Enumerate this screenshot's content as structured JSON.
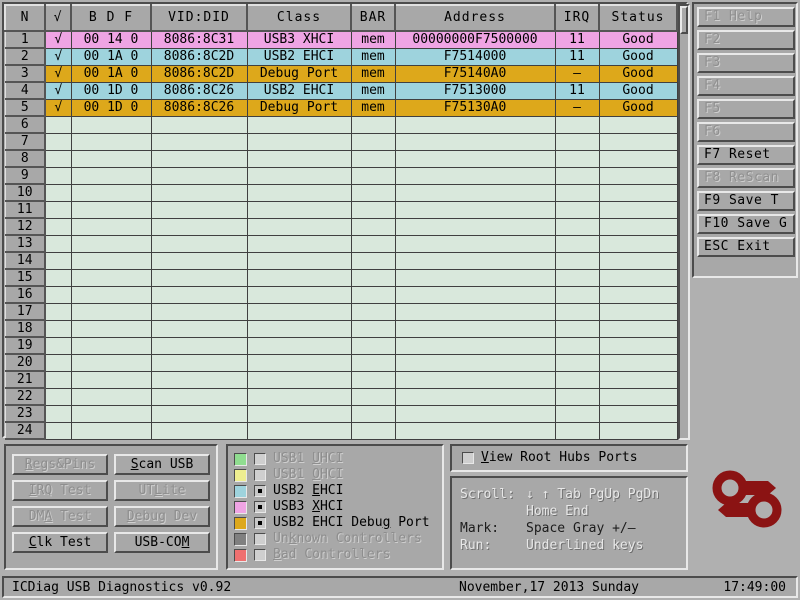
{
  "app": {
    "title": "ICDiag USB Diagnostics",
    "version": "v0.92"
  },
  "statusbar": {
    "left": "ICDiag USB Diagnostics  v0.92",
    "date": "November,17  2013  Sunday",
    "time": "17:49:00"
  },
  "table": {
    "columns": [
      "N",
      "√",
      "B  D  F",
      "VID:DID",
      "Class",
      "BAR",
      "Address",
      "IRQ",
      "Status"
    ],
    "rows": [
      {
        "n": "1",
        "mark": "√",
        "bdf": "00 14 0",
        "viddid": "8086:8C31",
        "class": "USB3 XHCI",
        "bar": "mem",
        "address": "00000000F7500000",
        "irq": "11",
        "status": "Good",
        "color": "c-magenta",
        "selected": false
      },
      {
        "n": "2",
        "mark": "√",
        "bdf": "00 1A 0",
        "viddid": "8086:8C2D",
        "class": "USB2 EHCI",
        "bar": "mem",
        "address": "F7514000",
        "irq": "11",
        "status": "Good",
        "color": "c-cyan",
        "selected": false
      },
      {
        "n": "3",
        "mark": "√",
        "bdf": "00 1A 0",
        "viddid": "8086:8C2D",
        "class": "Debug Port",
        "bar": "mem",
        "address": "F75140A0",
        "irq": "–",
        "status": "Good",
        "color": "c-amber",
        "selected": true
      },
      {
        "n": "4",
        "mark": "√",
        "bdf": "00 1D 0",
        "viddid": "8086:8C26",
        "class": "USB2 EHCI",
        "bar": "mem",
        "address": "F7513000",
        "irq": "11",
        "status": "Good",
        "color": "c-cyan",
        "selected": false
      },
      {
        "n": "5",
        "mark": "√",
        "bdf": "00 1D 0",
        "viddid": "8086:8C26",
        "class": "Debug Port",
        "bar": "mem",
        "address": "F75130A0",
        "irq": "–",
        "status": "Good",
        "color": "c-amber",
        "selected": false
      },
      {
        "n": "6",
        "mark": "",
        "bdf": "",
        "viddid": "",
        "class": "",
        "bar": "",
        "address": "",
        "irq": "",
        "status": "",
        "color": "c-empty",
        "selected": false
      },
      {
        "n": "7",
        "mark": "",
        "bdf": "",
        "viddid": "",
        "class": "",
        "bar": "",
        "address": "",
        "irq": "",
        "status": "",
        "color": "c-empty",
        "selected": false
      },
      {
        "n": "8",
        "mark": "",
        "bdf": "",
        "viddid": "",
        "class": "",
        "bar": "",
        "address": "",
        "irq": "",
        "status": "",
        "color": "c-empty",
        "selected": false
      },
      {
        "n": "9",
        "mark": "",
        "bdf": "",
        "viddid": "",
        "class": "",
        "bar": "",
        "address": "",
        "irq": "",
        "status": "",
        "color": "c-empty",
        "selected": false
      },
      {
        "n": "10",
        "mark": "",
        "bdf": "",
        "viddid": "",
        "class": "",
        "bar": "",
        "address": "",
        "irq": "",
        "status": "",
        "color": "c-empty",
        "selected": false
      },
      {
        "n": "11",
        "mark": "",
        "bdf": "",
        "viddid": "",
        "class": "",
        "bar": "",
        "address": "",
        "irq": "",
        "status": "",
        "color": "c-empty",
        "selected": false
      },
      {
        "n": "12",
        "mark": "",
        "bdf": "",
        "viddid": "",
        "class": "",
        "bar": "",
        "address": "",
        "irq": "",
        "status": "",
        "color": "c-empty",
        "selected": false
      },
      {
        "n": "13",
        "mark": "",
        "bdf": "",
        "viddid": "",
        "class": "",
        "bar": "",
        "address": "",
        "irq": "",
        "status": "",
        "color": "c-empty",
        "selected": false
      },
      {
        "n": "14",
        "mark": "",
        "bdf": "",
        "viddid": "",
        "class": "",
        "bar": "",
        "address": "",
        "irq": "",
        "status": "",
        "color": "c-empty",
        "selected": false
      },
      {
        "n": "15",
        "mark": "",
        "bdf": "",
        "viddid": "",
        "class": "",
        "bar": "",
        "address": "",
        "irq": "",
        "status": "",
        "color": "c-empty",
        "selected": false
      },
      {
        "n": "16",
        "mark": "",
        "bdf": "",
        "viddid": "",
        "class": "",
        "bar": "",
        "address": "",
        "irq": "",
        "status": "",
        "color": "c-empty",
        "selected": false
      },
      {
        "n": "17",
        "mark": "",
        "bdf": "",
        "viddid": "",
        "class": "",
        "bar": "",
        "address": "",
        "irq": "",
        "status": "",
        "color": "c-empty",
        "selected": false
      },
      {
        "n": "18",
        "mark": "",
        "bdf": "",
        "viddid": "",
        "class": "",
        "bar": "",
        "address": "",
        "irq": "",
        "status": "",
        "color": "c-empty",
        "selected": false
      },
      {
        "n": "19",
        "mark": "",
        "bdf": "",
        "viddid": "",
        "class": "",
        "bar": "",
        "address": "",
        "irq": "",
        "status": "",
        "color": "c-empty",
        "selected": false
      },
      {
        "n": "20",
        "mark": "",
        "bdf": "",
        "viddid": "",
        "class": "",
        "bar": "",
        "address": "",
        "irq": "",
        "status": "",
        "color": "c-empty",
        "selected": false
      },
      {
        "n": "21",
        "mark": "",
        "bdf": "",
        "viddid": "",
        "class": "",
        "bar": "",
        "address": "",
        "irq": "",
        "status": "",
        "color": "c-empty",
        "selected": false
      },
      {
        "n": "22",
        "mark": "",
        "bdf": "",
        "viddid": "",
        "class": "",
        "bar": "",
        "address": "",
        "irq": "",
        "status": "",
        "color": "c-empty",
        "selected": false
      },
      {
        "n": "23",
        "mark": "",
        "bdf": "",
        "viddid": "",
        "class": "",
        "bar": "",
        "address": "",
        "irq": "",
        "status": "",
        "color": "c-empty",
        "selected": false
      },
      {
        "n": "24",
        "mark": "",
        "bdf": "",
        "viddid": "",
        "class": "",
        "bar": "",
        "address": "",
        "irq": "",
        "status": "",
        "color": "c-empty",
        "selected": false
      }
    ]
  },
  "fkeys": [
    {
      "label": "F1 Help",
      "enabled": false,
      "name": "fkey-f1-help"
    },
    {
      "label": "F2",
      "enabled": false,
      "name": "fkey-f2"
    },
    {
      "label": "F3",
      "enabled": false,
      "name": "fkey-f3"
    },
    {
      "label": "F4",
      "enabled": false,
      "name": "fkey-f4"
    },
    {
      "label": "F5",
      "enabled": false,
      "name": "fkey-f5"
    },
    {
      "label": "F6",
      "enabled": false,
      "name": "fkey-f6"
    },
    {
      "label": "F7 Reset",
      "enabled": true,
      "name": "fkey-f7-reset"
    },
    {
      "label": "F8 ReScan",
      "enabled": false,
      "name": "fkey-f8-rescan"
    },
    {
      "label": "F9 Save T",
      "enabled": true,
      "name": "fkey-f9-save-t"
    },
    {
      "label": "F10 Save G",
      "enabled": true,
      "name": "fkey-f10-save-g"
    },
    {
      "label": "ESC Exit",
      "enabled": true,
      "name": "fkey-esc-exit"
    }
  ],
  "buttons": [
    {
      "pre": "",
      "acc": "R",
      "post": "egs&Pins",
      "enabled": false,
      "name": "regs-and-pins-button"
    },
    {
      "pre": "",
      "acc": "S",
      "post": "can USB",
      "enabled": true,
      "name": "scan-usb-button"
    },
    {
      "pre": "",
      "acc": "I",
      "post": "RQ Test",
      "enabled": false,
      "name": "irq-test-button"
    },
    {
      "pre": "UT",
      "acc": "L",
      "post": "ite",
      "enabled": false,
      "name": "utlite-button"
    },
    {
      "pre": "DM",
      "acc": "A",
      "post": " Test",
      "enabled": false,
      "name": "dma-test-button"
    },
    {
      "pre": "",
      "acc": "D",
      "post": "ebug Dev",
      "enabled": false,
      "name": "debug-dev-button"
    },
    {
      "pre": "",
      "acc": "C",
      "post": "lk Test",
      "enabled": true,
      "name": "clk-test-button"
    },
    {
      "pre": "USB-CO",
      "acc": "M",
      "post": "",
      "enabled": true,
      "name": "usb-com-button"
    }
  ],
  "legend": [
    {
      "swatch": "#90dd90",
      "checked": false,
      "enabled": false,
      "pre": "USB1 ",
      "acc": "U",
      "post": "HCI",
      "name": "legend-usb1-uhci"
    },
    {
      "swatch": "#eeee90",
      "checked": false,
      "enabled": false,
      "pre": "USB1 ",
      "acc": "O",
      "post": "HCI",
      "name": "legend-usb1-ohci"
    },
    {
      "swatch": "#9ed3dd",
      "checked": true,
      "enabled": true,
      "pre": "USB2 ",
      "acc": "E",
      "post": "HCI",
      "name": "legend-usb2-ehci"
    },
    {
      "swatch": "#efa4e4",
      "checked": true,
      "enabled": true,
      "pre": "USB3 ",
      "acc": "X",
      "post": "HCI",
      "name": "legend-usb3-xhci"
    },
    {
      "swatch": "#dda81b",
      "checked": true,
      "enabled": true,
      "pre": "USB2 EHCI Debu",
      "acc": "g",
      "post": " Port",
      "name": "legend-usb2-ehci-debug-port"
    },
    {
      "swatch": "#808080",
      "checked": false,
      "enabled": false,
      "pre": "Un",
      "acc": "k",
      "post": "nown Controllers",
      "name": "legend-unknown-controllers"
    },
    {
      "swatch": "#ef7070",
      "checked": false,
      "enabled": false,
      "pre": "",
      "acc": "B",
      "post": "ad Controllers",
      "name": "legend-bad-controllers"
    }
  ],
  "view_option": {
    "checked": false,
    "pre": "",
    "acc": "V",
    "post": "iew Root Hubs Ports"
  },
  "help": [
    {
      "label": "Scroll:",
      "value": "↓ ↑ Tab PgUp PgDn",
      "bold": false
    },
    {
      "label": "",
      "value": "Home End",
      "bold": false
    },
    {
      "label": "Mark:",
      "value": "Space Gray +/–",
      "bold": true
    },
    {
      "label": "Run:",
      "value": "Underlined keys",
      "bold": false
    }
  ],
  "colors": {
    "background": "#b0b0b0",
    "panel": "#a8a8a8",
    "logo": "#8b1313",
    "row_usb3_xhci": "#efa4e4",
    "row_usb2_ehci": "#9ed3dd",
    "row_debug_port": "#dda81b",
    "row_empty": "#d9e8dc",
    "selection": "#5fc8d8"
  }
}
